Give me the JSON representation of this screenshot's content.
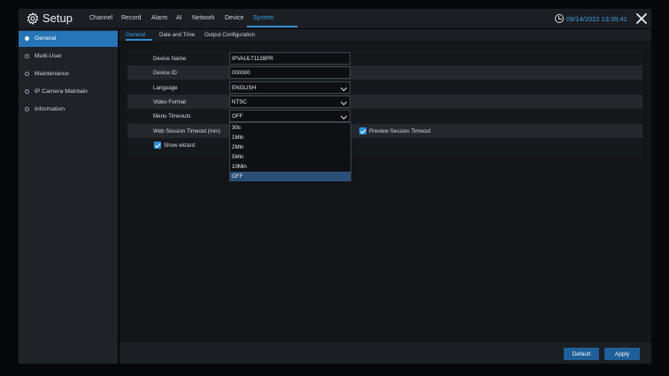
{
  "header": {
    "title": "Setup",
    "nav": [
      {
        "label": "Channel"
      },
      {
        "label": "Record"
      },
      {
        "label": "Alarm"
      },
      {
        "label": "AI"
      },
      {
        "label": "Network"
      },
      {
        "label": "Device"
      },
      {
        "label": "System"
      }
    ],
    "active_nav": "System",
    "datetime": "09/14/2022 13:35:41",
    "accent_color": "#2f8fd8"
  },
  "sidebar": {
    "items": [
      {
        "label": "General"
      },
      {
        "label": "Multi-User"
      },
      {
        "label": "Maintenance"
      },
      {
        "label": "IP Camera Maintain"
      },
      {
        "label": "Information"
      }
    ],
    "active_item": "General"
  },
  "subtabs": {
    "items": [
      {
        "label": "General"
      },
      {
        "label": "Date and Time"
      },
      {
        "label": "Output Configuration"
      }
    ],
    "active": "General"
  },
  "form": {
    "device_name": {
      "label": "Device Name",
      "value": "IPVAULT1128PR"
    },
    "device_id": {
      "label": "Device ID",
      "value": "000000"
    },
    "language": {
      "label": "Language",
      "value": "ENGLISH"
    },
    "video_format": {
      "label": "Video Format",
      "value": "NTSC"
    },
    "menu_timeouts": {
      "label": "Menu Timeouts",
      "value": "OFF"
    },
    "web_session_timeout": {
      "label": "Web Session Timeout (min)"
    },
    "preview_session_timeout": {
      "label": "Preview Session Timeout",
      "checked": true
    },
    "show_wizard": {
      "label": "Show wizard",
      "checked": true
    }
  },
  "dropdown": {
    "options": [
      "30s",
      "1Min",
      "2Min",
      "5Min",
      "10Min",
      "OFF"
    ],
    "selected": "OFF"
  },
  "footer": {
    "default_label": "Default",
    "apply_label": "Apply"
  },
  "icons": {
    "setup": "gear-icon",
    "clock": "clock-icon",
    "close": "close-icon",
    "checkbox": "checkmark-icon"
  }
}
